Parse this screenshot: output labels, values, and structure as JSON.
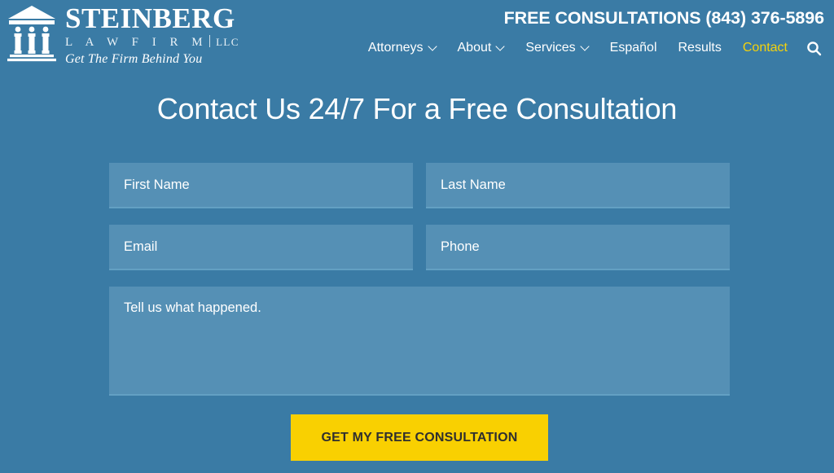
{
  "colors": {
    "page_background": "#3a7ba5",
    "field_background": "#5590b5",
    "accent_yellow": "#f5d20b",
    "button_yellow": "#f9d001",
    "button_text": "#2f2f2f",
    "text_white": "#ffffff"
  },
  "header": {
    "logo": {
      "icon": "courthouse-columns-icon",
      "name": "STEINBERG",
      "subtitle": "L A W   F I R M",
      "entity": "LLC",
      "tagline": "Get The Firm Behind You"
    },
    "phone_line": "FREE CONSULTATIONS (843) 376-5896",
    "nav": [
      {
        "label": "Attorneys",
        "has_dropdown": true,
        "active": false,
        "icon": "chevron-down-icon"
      },
      {
        "label": "About",
        "has_dropdown": true,
        "active": false,
        "icon": "chevron-down-icon"
      },
      {
        "label": "Services",
        "has_dropdown": true,
        "active": false,
        "icon": "chevron-down-icon"
      },
      {
        "label": "Español",
        "has_dropdown": false,
        "active": false,
        "icon": ""
      },
      {
        "label": "Results",
        "has_dropdown": false,
        "active": false,
        "icon": ""
      },
      {
        "label": "Contact",
        "has_dropdown": false,
        "active": true,
        "icon": ""
      }
    ],
    "search_icon": "search-icon"
  },
  "hero": {
    "title": "Contact Us 24/7 For a Free Consultation"
  },
  "form": {
    "fields": {
      "first_name": {
        "placeholder": "First Name",
        "value": ""
      },
      "last_name": {
        "placeholder": "Last Name",
        "value": ""
      },
      "email": {
        "placeholder": "Email",
        "value": ""
      },
      "phone": {
        "placeholder": "Phone",
        "value": ""
      },
      "message": {
        "placeholder": "Tell us what happened.",
        "value": ""
      }
    },
    "submit_label": "GET MY FREE CONSULTATION"
  }
}
